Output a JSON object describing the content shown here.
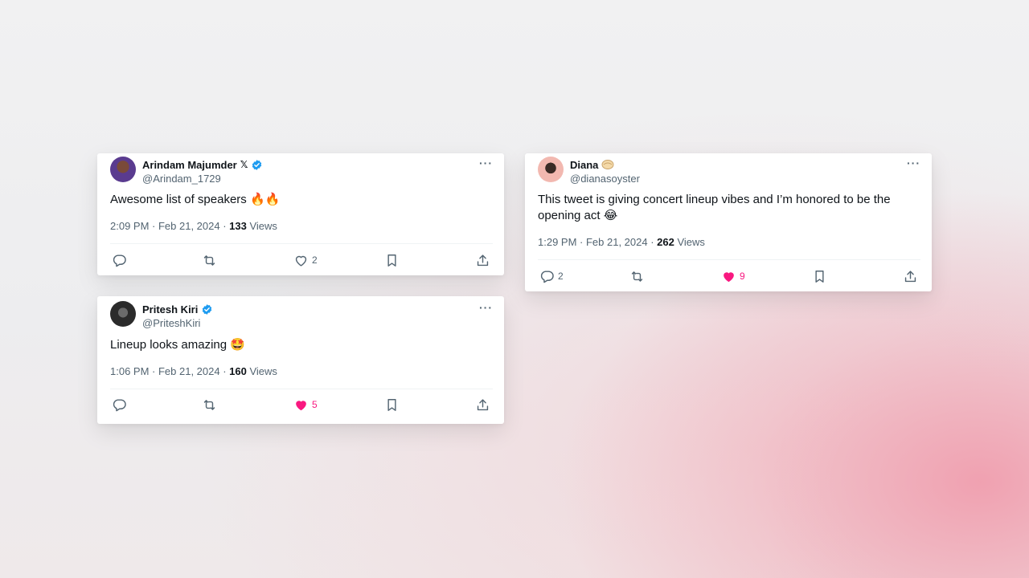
{
  "tweets": [
    {
      "name": "Arindam Majumder",
      "name_icon": "x-logo-icon",
      "verified": true,
      "handle": "@Arindam_1729",
      "text": "Awesome list of speakers 🔥🔥",
      "time": "2:09 PM · Feb 21, 2024 · ",
      "views_count": "133",
      "views_label": " Views",
      "reply_count": "",
      "like_count": "2",
      "liked": false
    },
    {
      "name": "Pritesh Kiri",
      "verified": true,
      "handle": "@PriteshKiri",
      "text": "Lineup looks amazing 🤩",
      "time": "1:06 PM · Feb 21, 2024 · ",
      "views_count": "160",
      "views_label": " Views",
      "reply_count": "",
      "like_count": "5",
      "liked": true
    },
    {
      "name": "Diana",
      "name_icon": "oyster-emoji",
      "verified": false,
      "handle": "@dianasoyster",
      "text_line1": "This tweet is giving concert lineup vibes and I’m honored to be the",
      "text_line2": "opening act 😂",
      "time": "1:29 PM · Feb 21, 2024 · ",
      "views_count": "262",
      "views_label": " Views",
      "reply_count": "2",
      "like_count": "9",
      "liked": true
    }
  ],
  "colors": {
    "verified": "#1d9bf0",
    "like": "#f91880",
    "icon": "#536471",
    "text": "#0f1419"
  }
}
